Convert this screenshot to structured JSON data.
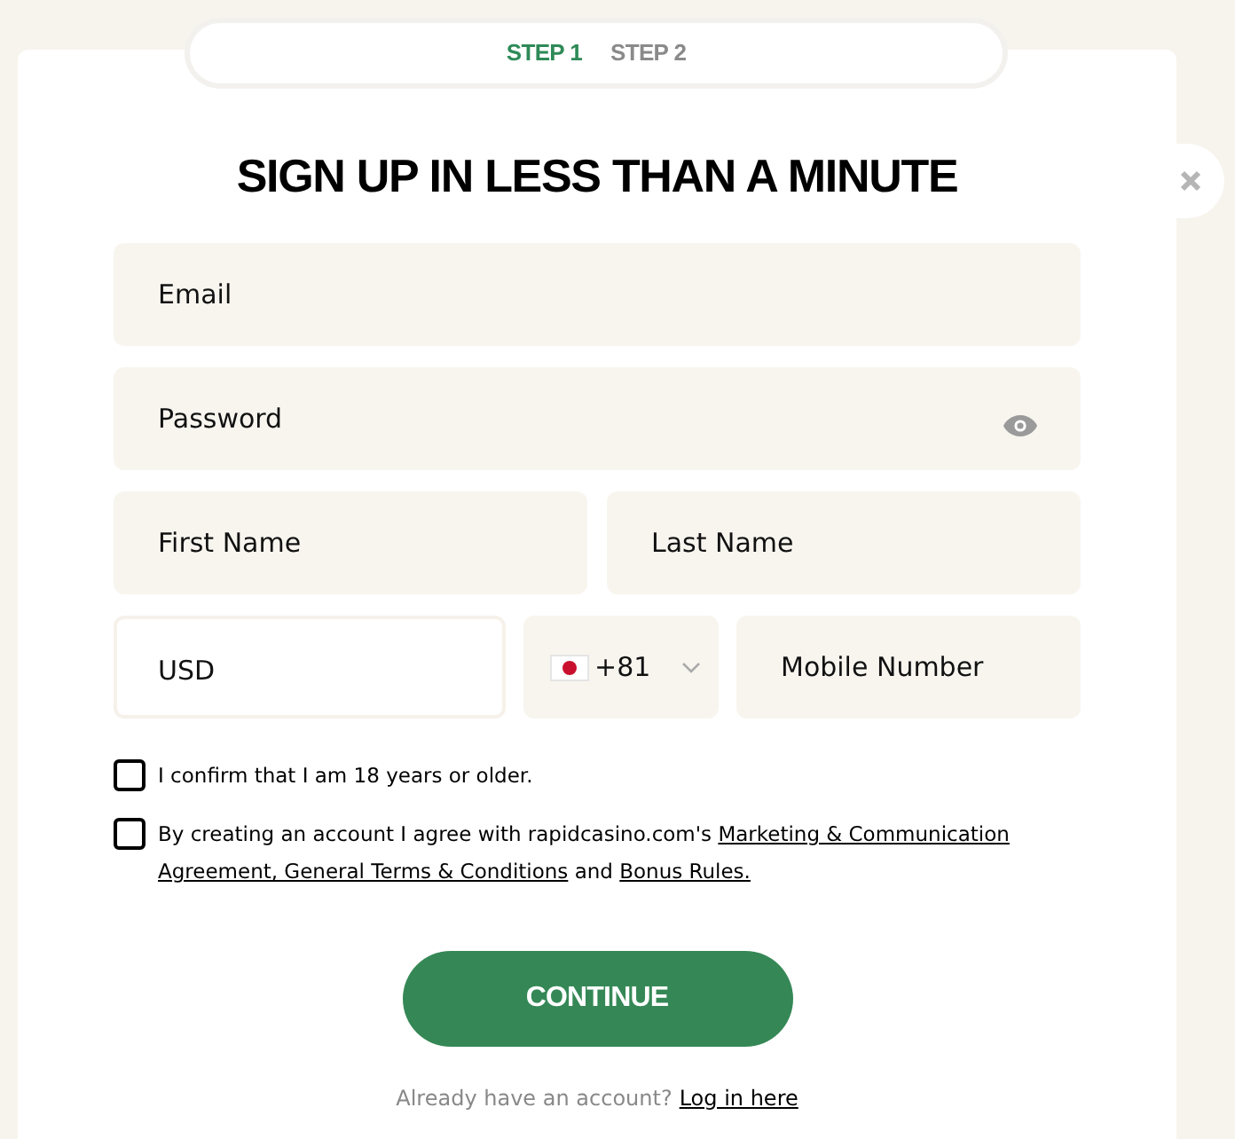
{
  "steps": [
    {
      "label": "STEP 1",
      "selected": true
    },
    {
      "label": "STEP 2",
      "selected": false
    }
  ],
  "title": "SIGN UP IN LESS THAN A MINUTE",
  "fields": {
    "email": {
      "placeholder": "Email"
    },
    "password": {
      "placeholder": "Password"
    },
    "first_name": {
      "placeholder": "First Name"
    },
    "last_name": {
      "placeholder": "Last Name"
    },
    "currency": {
      "value": "USD"
    },
    "country_code": {
      "value": "+81"
    },
    "mobile": {
      "placeholder": "Mobile Number"
    }
  },
  "consents": [
    {
      "checked": false,
      "parts": [
        {
          "kind": "text",
          "text": "I confirm that I am 18 years or older."
        }
      ]
    },
    {
      "checked": false,
      "parts": [
        {
          "kind": "text",
          "text": "By creating an account I agree with rapidcasino.com's "
        },
        {
          "kind": "link_lines",
          "lines": [
            "Marketing & Communication",
            "Agreement, General Terms & Conditions"
          ]
        },
        {
          "kind": "text",
          "text": " and "
        },
        {
          "kind": "link",
          "text": "Bonus Rules."
        }
      ]
    }
  ],
  "continue_button": "CONTINUE",
  "login_prompt": {
    "text": "Already have an account?",
    "link": "Log in here"
  }
}
